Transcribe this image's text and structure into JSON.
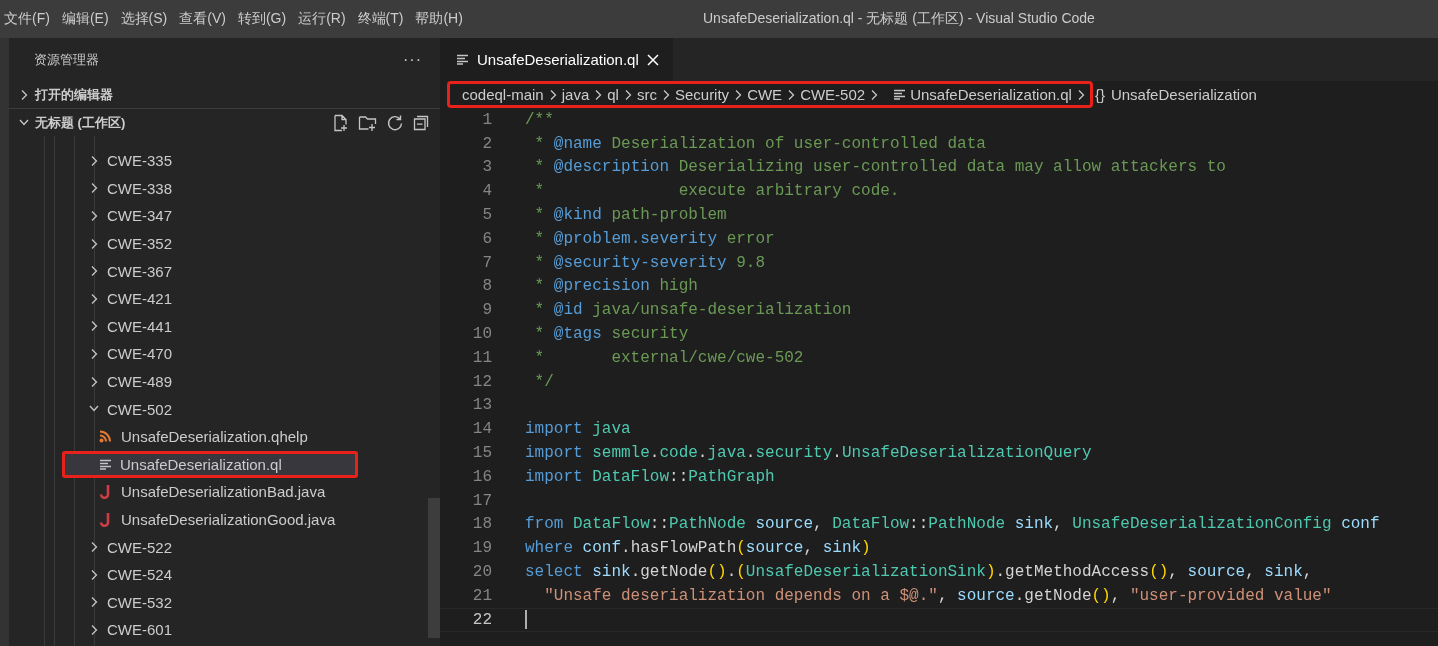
{
  "menu": [
    "文件(F)",
    "编辑(E)",
    "选择(S)",
    "查看(V)",
    "转到(G)",
    "运行(R)",
    "终端(T)",
    "帮助(H)"
  ],
  "window": {
    "title": "UnsafeDeserialization.ql - 无标题 (工作区) - Visual Studio Code"
  },
  "sidebar": {
    "title": "资源管理器",
    "more": "···",
    "sections": [
      {
        "title": "打开的编辑器",
        "expanded": false
      },
      {
        "title": "无标题 (工作区)",
        "expanded": true,
        "tree": [
          {
            "label": "CWE-335",
            "kind": "folder",
            "expanded": false,
            "selected": false
          },
          {
            "label": "CWE-338",
            "kind": "folder",
            "expanded": false,
            "selected": false
          },
          {
            "label": "CWE-347",
            "kind": "folder",
            "expanded": false,
            "selected": false
          },
          {
            "label": "CWE-352",
            "kind": "folder",
            "expanded": false,
            "selected": false
          },
          {
            "label": "CWE-367",
            "kind": "folder",
            "expanded": false,
            "selected": false
          },
          {
            "label": "CWE-421",
            "kind": "folder",
            "expanded": false,
            "selected": false
          },
          {
            "label": "CWE-441",
            "kind": "folder",
            "expanded": false,
            "selected": false
          },
          {
            "label": "CWE-470",
            "kind": "folder",
            "expanded": false,
            "selected": false
          },
          {
            "label": "CWE-489",
            "kind": "folder",
            "expanded": false,
            "selected": false
          },
          {
            "label": "CWE-502",
            "kind": "folder",
            "expanded": true,
            "selected": false,
            "children": [
              {
                "label": "UnsafeDeserialization.qhelp",
                "kind": "qhelp",
                "selected": false,
                "annotated": false
              },
              {
                "label": "UnsafeDeserialization.ql",
                "kind": "ql",
                "selected": true,
                "annotated": true
              },
              {
                "label": "UnsafeDeserializationBad.java",
                "kind": "java",
                "selected": false,
                "annotated": false
              },
              {
                "label": "UnsafeDeserializationGood.java",
                "kind": "java",
                "selected": false,
                "annotated": false
              }
            ]
          },
          {
            "label": "CWE-522",
            "kind": "folder",
            "expanded": false,
            "selected": false
          },
          {
            "label": "CWE-524",
            "kind": "folder",
            "expanded": false,
            "selected": false
          },
          {
            "label": "CWE-532",
            "kind": "folder",
            "expanded": false,
            "selected": false
          },
          {
            "label": "CWE-601",
            "kind": "folder",
            "expanded": false,
            "selected": false
          }
        ]
      }
    ]
  },
  "tabs": [
    {
      "label": "UnsafeDeserialization.ql",
      "selected": true
    }
  ],
  "breadcrumb": {
    "path": [
      "codeql-main",
      "java",
      "ql",
      "src",
      "Security",
      "CWE",
      "CWE-502"
    ],
    "file": "UnsafeDeserialization.ql",
    "annotated": true,
    "symbol_icon": "{}",
    "symbol": "UnsafeDeserialization"
  },
  "editor": {
    "lines": [
      {
        "number": "1",
        "tokens": [
          {
            "kind": "comment",
            "text": "/**"
          }
        ]
      },
      {
        "number": "2",
        "tokens": [
          {
            "kind": "comment",
            "text": " * "
          },
          {
            "kind": "tag",
            "text": "@name"
          },
          {
            "kind": "comment",
            "text": " Deserialization of user-controlled data"
          }
        ]
      },
      {
        "number": "3",
        "tokens": [
          {
            "kind": "comment",
            "text": " * "
          },
          {
            "kind": "tag",
            "text": "@description"
          },
          {
            "kind": "comment",
            "text": " Deserializing user-controlled data may allow attackers to"
          }
        ]
      },
      {
        "number": "4",
        "tokens": [
          {
            "kind": "comment",
            "text": " *              execute arbitrary code."
          }
        ]
      },
      {
        "number": "5",
        "tokens": [
          {
            "kind": "comment",
            "text": " * "
          },
          {
            "kind": "tag",
            "text": "@kind"
          },
          {
            "kind": "comment",
            "text": " path-problem"
          }
        ]
      },
      {
        "number": "6",
        "tokens": [
          {
            "kind": "comment",
            "text": " * "
          },
          {
            "kind": "tag",
            "text": "@problem.severity"
          },
          {
            "kind": "comment",
            "text": " error"
          }
        ]
      },
      {
        "number": "7",
        "tokens": [
          {
            "kind": "comment",
            "text": " * "
          },
          {
            "kind": "tag",
            "text": "@security-severity"
          },
          {
            "kind": "comment",
            "text": " 9.8"
          }
        ]
      },
      {
        "number": "8",
        "tokens": [
          {
            "kind": "comment",
            "text": " * "
          },
          {
            "kind": "tag",
            "text": "@precision"
          },
          {
            "kind": "comment",
            "text": " high"
          }
        ]
      },
      {
        "number": "9",
        "tokens": [
          {
            "kind": "comment",
            "text": " * "
          },
          {
            "kind": "tag",
            "text": "@id"
          },
          {
            "kind": "comment",
            "text": " java/unsafe-deserialization"
          }
        ]
      },
      {
        "number": "10",
        "tokens": [
          {
            "kind": "comment",
            "text": " * "
          },
          {
            "kind": "tag",
            "text": "@tags"
          },
          {
            "kind": "comment",
            "text": " security"
          }
        ]
      },
      {
        "number": "11",
        "tokens": [
          {
            "kind": "comment",
            "text": " *       external/cwe/cwe-502"
          }
        ]
      },
      {
        "number": "12",
        "tokens": [
          {
            "kind": "comment",
            "text": " */"
          }
        ]
      },
      {
        "number": "13"
      },
      {
        "number": "14",
        "tokens": [
          {
            "kind": "keyword",
            "text": "import"
          },
          {
            "kind": "type",
            "text": " java"
          }
        ]
      },
      {
        "number": "15",
        "tokens": [
          {
            "kind": "keyword",
            "text": "import"
          },
          {
            "kind": "type",
            "text": " semmle"
          },
          {
            "kind": "plain",
            "text": "."
          },
          {
            "kind": "type",
            "text": "code"
          },
          {
            "kind": "plain",
            "text": "."
          },
          {
            "kind": "type",
            "text": "java"
          },
          {
            "kind": "plain",
            "text": "."
          },
          {
            "kind": "type",
            "text": "security"
          },
          {
            "kind": "plain",
            "text": "."
          },
          {
            "kind": "type",
            "text": "UnsafeDeserializationQuery"
          }
        ]
      },
      {
        "number": "16",
        "tokens": [
          {
            "kind": "keyword",
            "text": "import"
          },
          {
            "kind": "type",
            "text": " DataFlow"
          },
          {
            "kind": "plain",
            "text": "::"
          },
          {
            "kind": "type",
            "text": "PathGraph"
          }
        ]
      },
      {
        "number": "17"
      },
      {
        "number": "18",
        "tokens": [
          {
            "kind": "keyword",
            "text": "from"
          },
          {
            "kind": "type",
            "text": " DataFlow"
          },
          {
            "kind": "plain",
            "text": "::"
          },
          {
            "kind": "type",
            "text": "PathNode"
          },
          {
            "kind": "ident",
            "text": " source"
          },
          {
            "kind": "plain",
            "text": ", "
          },
          {
            "kind": "type",
            "text": "DataFlow"
          },
          {
            "kind": "plain",
            "text": "::"
          },
          {
            "kind": "type",
            "text": "PathNode"
          },
          {
            "kind": "ident",
            "text": " sink"
          },
          {
            "kind": "plain",
            "text": ", "
          },
          {
            "kind": "type",
            "text": "UnsafeDeserializationConfig"
          },
          {
            "kind": "ident",
            "text": " conf"
          }
        ]
      },
      {
        "number": "19",
        "tokens": [
          {
            "kind": "keyword",
            "text": "where"
          },
          {
            "kind": "ident",
            "text": " conf"
          },
          {
            "kind": "plain",
            "text": ".hasFlowPath"
          },
          {
            "kind": "paren",
            "text": "("
          },
          {
            "kind": "ident",
            "text": "source"
          },
          {
            "kind": "plain",
            "text": ", "
          },
          {
            "kind": "ident",
            "text": "sink"
          },
          {
            "kind": "paren",
            "text": ")"
          }
        ]
      },
      {
        "number": "20",
        "tokens": [
          {
            "kind": "keyword",
            "text": "select"
          },
          {
            "kind": "ident",
            "text": " sink"
          },
          {
            "kind": "plain",
            "text": ".getNode"
          },
          {
            "kind": "paren",
            "text": "()"
          },
          {
            "kind": "plain",
            "text": "."
          },
          {
            "kind": "paren",
            "text": "("
          },
          {
            "kind": "type",
            "text": "UnsafeDeserializationSink"
          },
          {
            "kind": "paren",
            "text": ")"
          },
          {
            "kind": "plain",
            "text": ".getMethodAccess"
          },
          {
            "kind": "paren",
            "text": "()"
          },
          {
            "kind": "plain",
            "text": ", "
          },
          {
            "kind": "ident",
            "text": "source"
          },
          {
            "kind": "plain",
            "text": ", "
          },
          {
            "kind": "ident",
            "text": "sink"
          },
          {
            "kind": "plain",
            "text": ","
          }
        ]
      },
      {
        "number": "21",
        "tokens": [
          {
            "kind": "string",
            "text": "  \"Unsafe deserialization depends on a $@.\""
          },
          {
            "kind": "plain",
            "text": ", "
          },
          {
            "kind": "ident",
            "text": "source"
          },
          {
            "kind": "plain",
            "text": ".getNode"
          },
          {
            "kind": "paren",
            "text": "()"
          },
          {
            "kind": "plain",
            "text": ", "
          },
          {
            "kind": "string",
            "text": "\"user-provided value\""
          }
        ]
      },
      {
        "number": "22",
        "current": true
      }
    ]
  }
}
